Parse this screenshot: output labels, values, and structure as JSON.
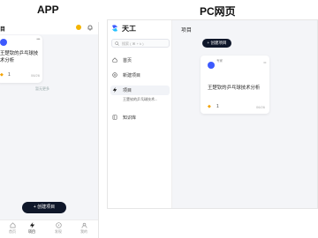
{
  "headings": {
    "app": "APP",
    "pc": "PC网页"
  },
  "app": {
    "header_title": "目",
    "card": {
      "title": "王楚钦的乒乓球技术分析",
      "count": "1",
      "date": "06/26"
    },
    "hint": "暂无更多",
    "create_button": "+ 创建项目",
    "tabs": [
      {
        "label": "首页",
        "icon": "home-icon"
      },
      {
        "label": "项目",
        "icon": "lightning-icon"
      },
      {
        "label": "发现",
        "icon": "compass-icon"
      },
      {
        "label": "我的",
        "icon": "user-icon"
      }
    ]
  },
  "pc": {
    "brand": "天工",
    "search_placeholder": "搜索 ( ⌘ + k )",
    "nav": [
      {
        "label": "首页",
        "icon": "home-icon"
      },
      {
        "label": "新建项目",
        "icon": "plus-circle-icon"
      },
      {
        "label": "项目",
        "icon": "lightning-icon"
      },
      {
        "label": "知识库",
        "icon": "book-icon"
      }
    ],
    "nav_sub": "王楚钦的乒乓球技术...",
    "main_title": "项目",
    "create_button": "+ 创建项目",
    "card": {
      "tag": "专家",
      "title": "王楚钦的乒乓球技术分析",
      "count": "1",
      "date": "06/26"
    }
  },
  "colors": {
    "accent": "#3d5afe",
    "dark_button": "#0f172a",
    "badge": "#f4a300"
  }
}
